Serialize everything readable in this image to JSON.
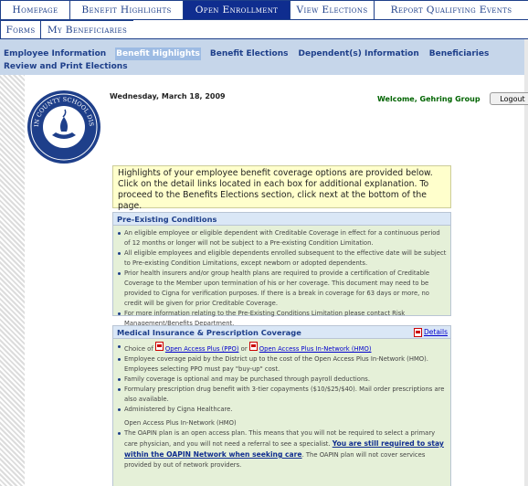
{
  "nav": {
    "row1": [
      {
        "label": "Homepage",
        "w": 76
      },
      {
        "label": "Benefit Highlights",
        "w": 124
      },
      {
        "label": "Open Enrollment",
        "w": 117,
        "selected": true
      },
      {
        "label": "View Elections",
        "w": 92
      },
      {
        "label": "Report Qualifying Events",
        "w": 169
      }
    ],
    "row2": [
      {
        "label": "Forms",
        "w": 44
      },
      {
        "label": "My Beneficiaries",
        "w": 102
      }
    ]
  },
  "subnav": {
    "items": [
      "Employee Information",
      "Benefit Highlights",
      "Benefit Elections",
      "Dependent(s) Information",
      "Beneficiaries",
      "Review and Print Elections"
    ],
    "active": "Benefit Highlights"
  },
  "logo": {
    "text": "MARTIN COUNTY SCHOOL DISTRICT"
  },
  "header": {
    "date": "Wednesday, March 18, 2009",
    "welcome": "Welcome, Gehring Group",
    "logout": "Logout"
  },
  "intro": "Highlights of your employee benefit coverage options are provided below. Click on the detail links located in each box for additional explanation. To proceed to the Benefits Elections section, click next at the bottom of the page.",
  "pre": {
    "title": "Pre-Existing Conditions",
    "items": [
      "An eligible employee or eligible dependent with Creditable Coverage in effect for a continuous period of 12 months or longer will not be subject to a Pre-existing Condition Limitation.",
      "All eligible employees and eligible dependents enrolled subsequent to the effective date will be subject to Pre-existing Condition Limitations, except newborn or adopted dependents.",
      "Prior health insurers and/or group health plans are required to provide a certification of Creditable Coverage to the Member upon termination of his or her coverage. This document may need to be provided to Cigna for verification purposes. If there is a break in coverage for 63 days or more, no credit will be given for prior Creditable Coverage.",
      "For more information relating to the Pre-Existing Conditions Limitation please contact Risk Management/Benefits Department."
    ]
  },
  "med": {
    "title": "Medical Insurance & Prescription Coverage",
    "details": "Details",
    "choice_prefix": "Choice of",
    "choice_mid": "or",
    "ppo": "Open Access Plus (PPO)",
    "hmo": "Open Access Plus In-Network (HMO)",
    "items": [
      "Employee coverage paid by the District up to the cost of the Open Access Plus In-Network (HMO). Employees selecting PPO must pay \"buy-up\" cost.",
      "Family coverage is optional and may be purchased through payroll deductions.",
      "Formulary prescription drug benefit with 3-tier copayments ($10/$25/$40). Mail order prescriptions are also available.",
      "Administered by Cigna Healthcare."
    ],
    "plan_heading": "Open Access Plus In-Network (HMO)",
    "oapin_a": "The OAPIN plan is an open access plan. This means that you will not be required to select a primary care physician, and you will not need a referral to see a specialist.",
    "oapin_bold": "You are still required to stay within the OAPIN Network when seeking care",
    "oapin_b": ". The OAPIN plan will not cover services provided by out of network providers."
  }
}
